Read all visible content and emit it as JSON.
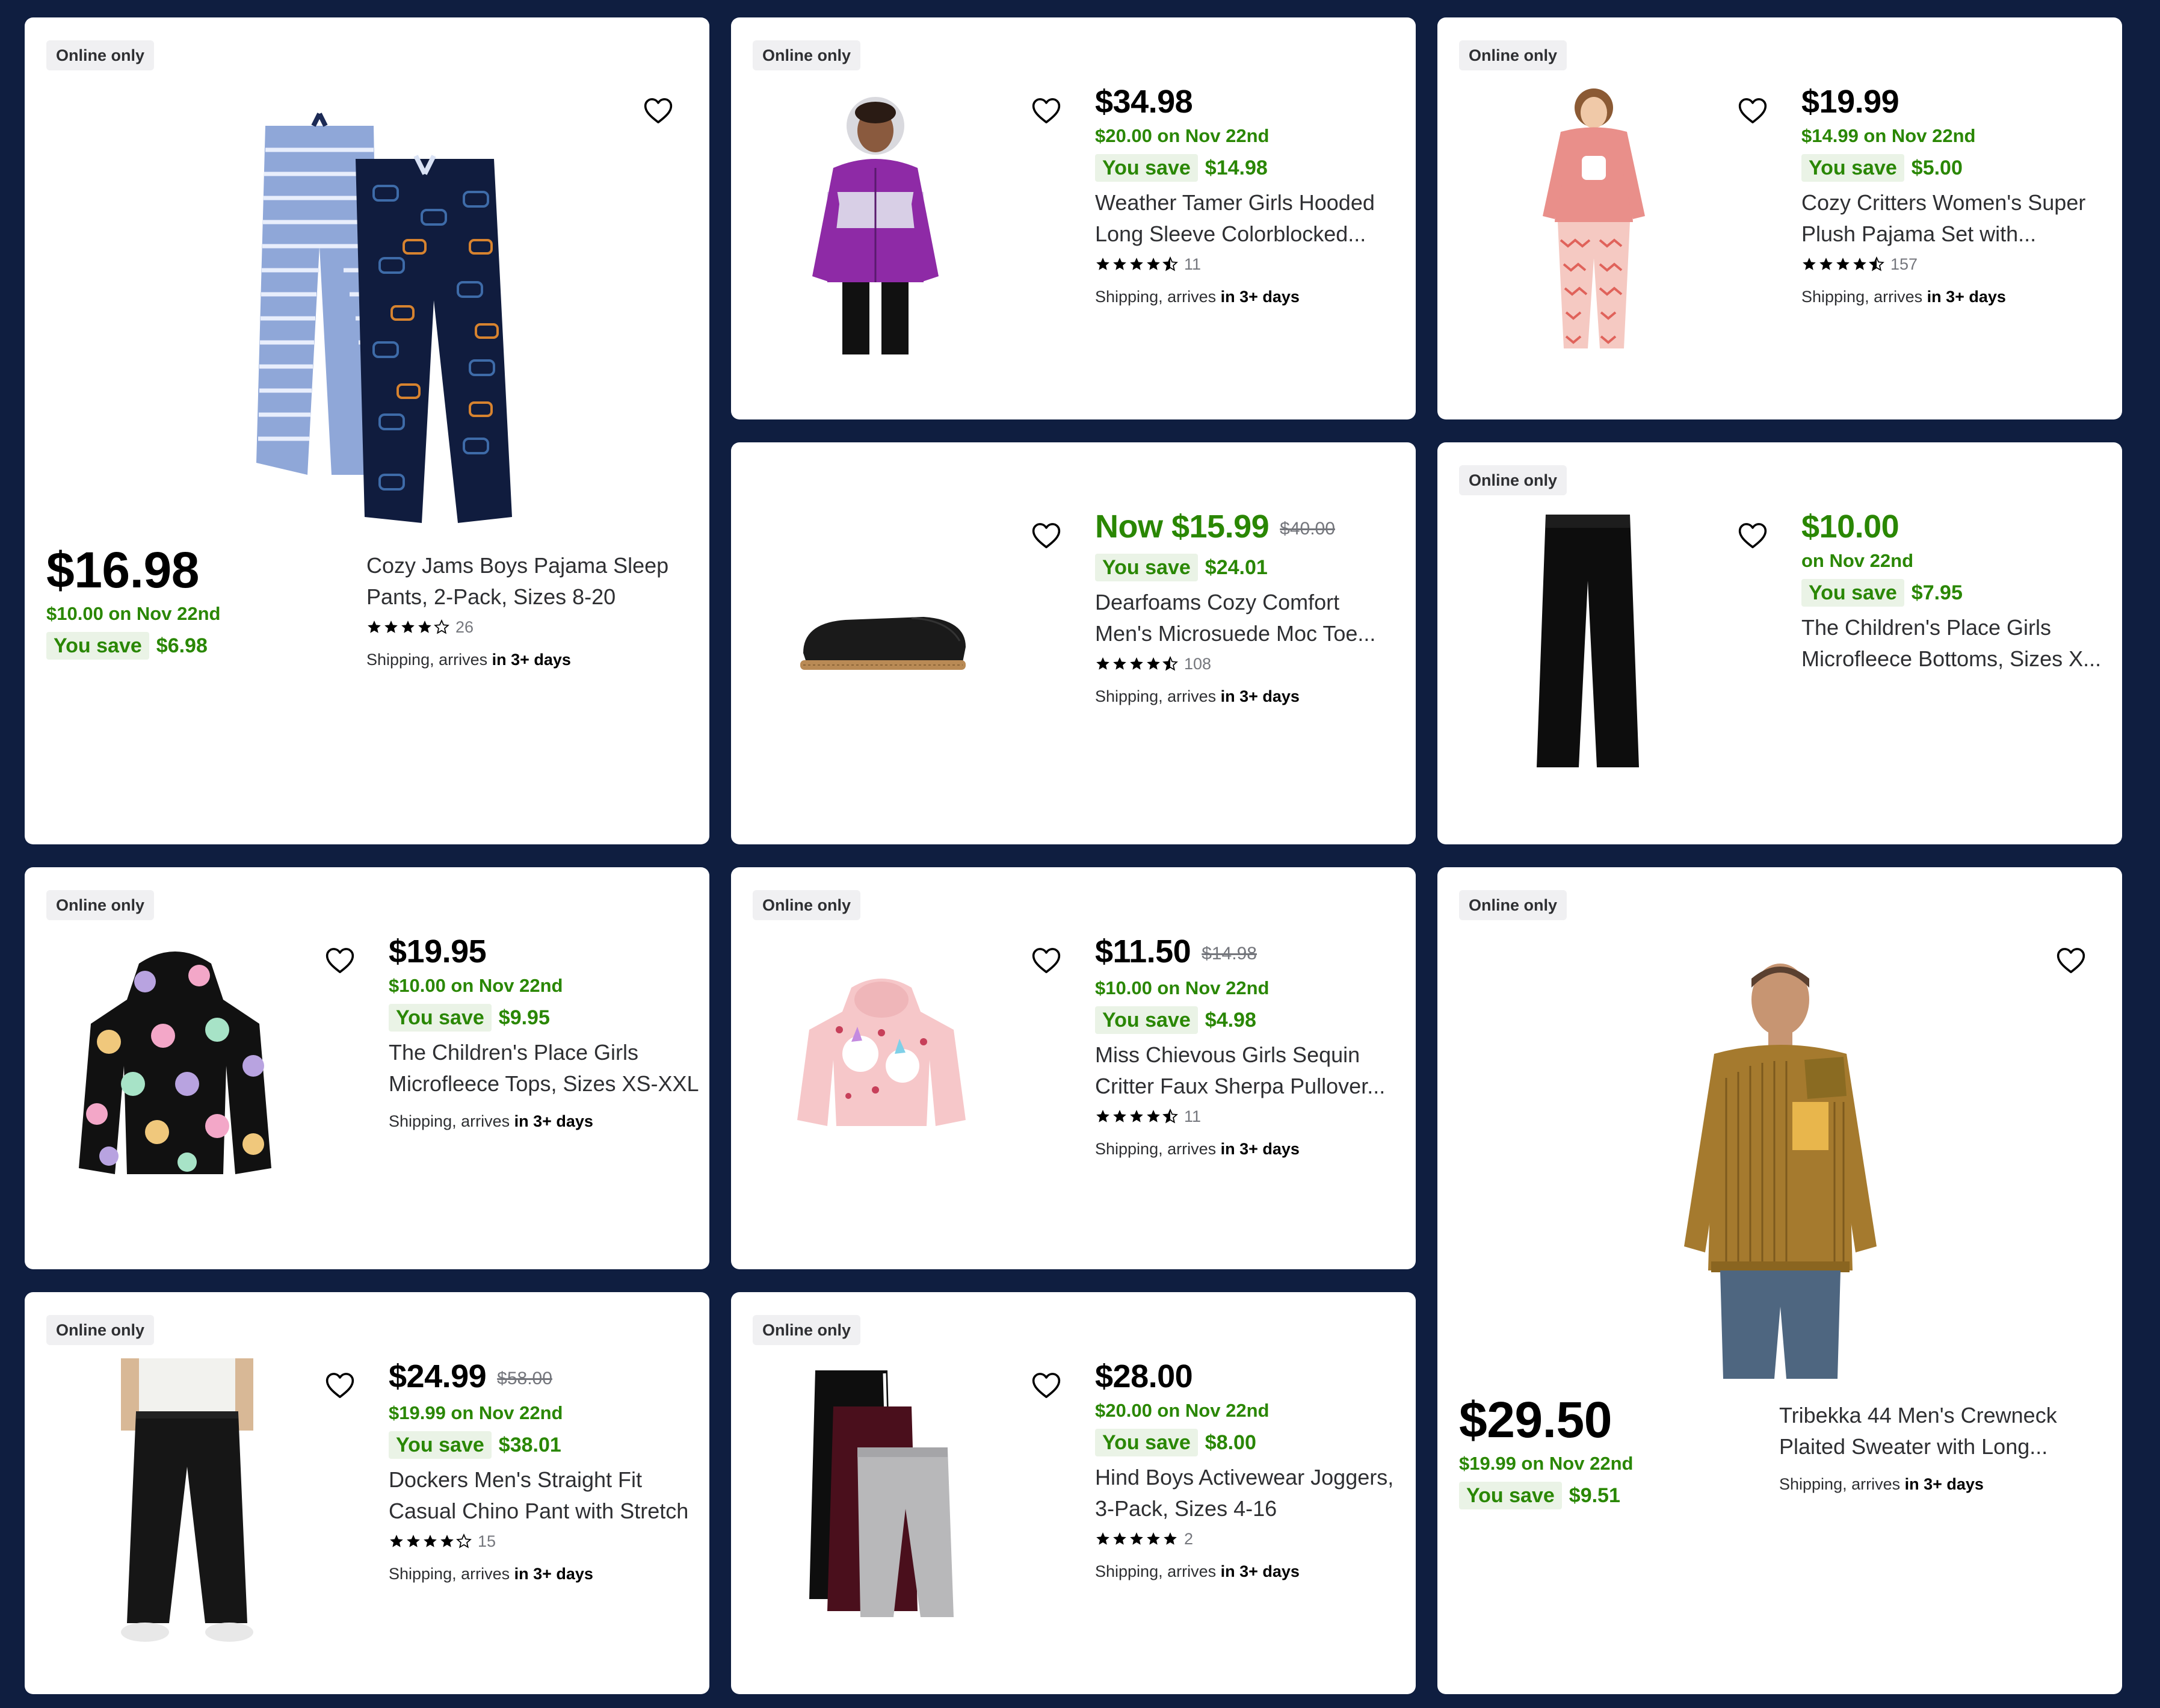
{
  "badge_text": "Online only",
  "shipping_prefix": "Shipping, arrives",
  "shipping_suffix": "in 3+ days",
  "savings_label": "You save",
  "products": [
    {
      "id": "cozy-jams",
      "online_only": true,
      "price": "$16.98",
      "deal": "$10.00 on Nov 22nd",
      "you_save": "$6.98",
      "title_line1": "Cozy Jams Boys Pajama Sleep",
      "title_line2": "Pants, 2-Pack, Sizes 8-20",
      "rating": 4,
      "review_count": "26",
      "image_icon": "pajama-pants-icon"
    },
    {
      "id": "weather-tamer",
      "online_only": true,
      "price": "$34.98",
      "deal": "$20.00 on Nov 22nd",
      "you_save": "$14.98",
      "title_line1": "Weather Tamer Girls Hooded",
      "title_line2": "Long Sleeve Colorblocked...",
      "rating": 4.5,
      "review_count": "11",
      "image_icon": "puffer-jacket-icon"
    },
    {
      "id": "cozy-critters",
      "online_only": true,
      "price": "$19.99",
      "deal": "$14.99 on Nov 22nd",
      "you_save": "$5.00",
      "title_line1": "Cozy Critters Women's Super",
      "title_line2": "Plush Pajama Set with...",
      "rating": 4.5,
      "review_count": "157",
      "image_icon": "pajama-set-icon"
    },
    {
      "id": "dearfoams",
      "online_only": false,
      "price": "Now $15.99",
      "was_price": "$40.00",
      "you_save": "$24.01",
      "title_line1": "Dearfoams Cozy Comfort",
      "title_line2": "Men's Microsuede Moc Toe...",
      "rating": 4.5,
      "review_count": "108",
      "image_icon": "slipper-icon"
    },
    {
      "id": "childrens-place-bottoms",
      "online_only": true,
      "price": "$10.00",
      "deal": "on Nov 22nd",
      "you_save": "$7.95",
      "title_line1": "The Children's Place Girls",
      "title_line2": "Microfleece Bottoms, Sizes X...",
      "image_icon": "black-pants-icon"
    },
    {
      "id": "childrens-place-tops",
      "online_only": true,
      "price": "$19.95",
      "deal": "$10.00 on Nov 22nd",
      "you_save": "$9.95",
      "title_line1": "The Children's Place Girls",
      "title_line2": "Microfleece Tops, Sizes XS-XXL",
      "image_icon": "smiley-hoodie-icon"
    },
    {
      "id": "miss-chievous",
      "online_only": true,
      "price": "$11.50",
      "was_price": "$14.98",
      "deal": "$10.00 on Nov 22nd",
      "you_save": "$4.98",
      "title_line1": "Miss Chievous Girls Sequin",
      "title_line2": "Critter Faux Sherpa Pullover...",
      "rating": 4.5,
      "review_count": "11",
      "image_icon": "unicorn-hoodie-icon"
    },
    {
      "id": "tribekka",
      "online_only": true,
      "price": "$29.50",
      "deal": "$19.99 on Nov 22nd",
      "you_save": "$9.51",
      "title_line1": "Tribekka 44 Men's Crewneck",
      "title_line2": "Plaited Sweater with Long...",
      "image_icon": "sweater-model-icon"
    },
    {
      "id": "dockers",
      "online_only": true,
      "price": "$24.99",
      "was_price": "$58.00",
      "deal": "$19.99 on Nov 22nd",
      "you_save": "$38.01",
      "title_line1": "Dockers Men's Straight Fit",
      "title_line2": "Casual Chino Pant with Stretch",
      "rating": 4,
      "review_count": "15",
      "image_icon": "chino-pants-icon"
    },
    {
      "id": "hind-joggers",
      "online_only": true,
      "price": "$28.00",
      "deal": "$20.00 on Nov 22nd",
      "you_save": "$8.00",
      "title_line1": "Hind Boys Activewear Joggers,",
      "title_line2": "3-Pack, Sizes 4-16",
      "rating": 5,
      "review_count": "2",
      "image_icon": "joggers-icon"
    }
  ],
  "colors": {
    "background": "#0f1e40",
    "deal_green": "#2a8703",
    "savings_bg": "#eaf3e6",
    "badge_bg": "#f0f0f2"
  }
}
